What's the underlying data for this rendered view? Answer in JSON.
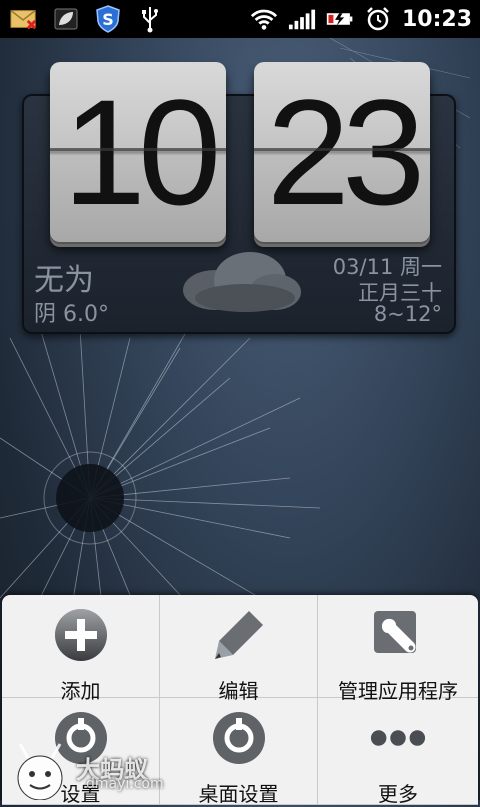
{
  "status_bar": {
    "left_icons": [
      "email-error-icon",
      "leaf-icon",
      "shield-s-icon",
      "usb-icon"
    ],
    "right_icons": [
      "wifi-icon",
      "signal-icon",
      "battery-charging-icon",
      "alarm-icon"
    ],
    "time": "10:23"
  },
  "clock_widget": {
    "hour": "10",
    "minute": "23",
    "city": "无为",
    "condition": "阴 6.0°",
    "date": "03/11 周一",
    "lunar_date": "正月三十",
    "temp_range": "8~12°",
    "weather_icon": "cloud-icon"
  },
  "menu": {
    "items": [
      {
        "label": "添加",
        "icon": "add-icon"
      },
      {
        "label": "编辑",
        "icon": "pencil-icon"
      },
      {
        "label": "管理应用程序",
        "icon": "wrench-icon"
      },
      {
        "label": "设置",
        "icon": "settings-icon"
      },
      {
        "label": "桌面设置",
        "icon": "desktop-settings-icon"
      },
      {
        "label": "更多",
        "icon": "more-icon"
      }
    ]
  },
  "watermark": {
    "text": "大蚂蚁",
    "url": "dmayi.com"
  },
  "colors": {
    "status_bar_bg": "#000000",
    "menu_bg": "#f1f1f1",
    "widget_text": "#8a94a0"
  }
}
